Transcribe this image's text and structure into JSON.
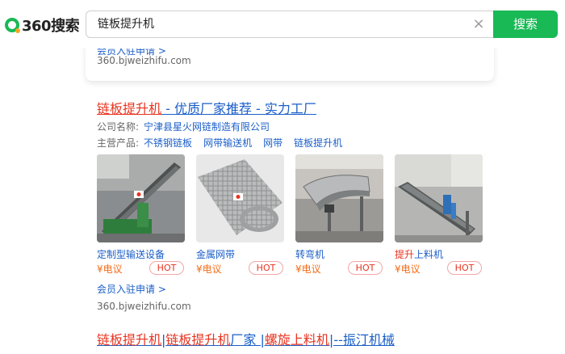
{
  "header": {
    "logo_text": "360搜索",
    "search_value": "链板提升机",
    "clear_glyph": "×",
    "search_button": "搜索",
    "accent_color": "#19b955"
  },
  "dropdown_card": {
    "member_link": "会员入驻申请 >",
    "url": "360.bjweizhifu.com"
  },
  "result1": {
    "title_highlight": "链板提升机",
    "title_rest": " - 优质厂家推荐 - 实力工厂",
    "company_label": "公司名称:",
    "company_value": "宁津县星火网链制造有限公司",
    "products_label": "主营产品:",
    "main_products": [
      "不锈钢链板",
      "网带输送机",
      "网带",
      "链板提升机"
    ],
    "products": [
      {
        "name": "定制型输送设备",
        "price": "¥电议",
        "badge": "HOT",
        "image": "inclined-conveyor-photo"
      },
      {
        "name": "金属网带",
        "price": "¥电议",
        "badge": "HOT",
        "image": "metal-mesh-belt-photo"
      },
      {
        "name": "转弯机",
        "price": "¥电议",
        "badge": "HOT",
        "image": "curved-conveyor-photo"
      },
      {
        "name_highlight": "提升",
        "name_rest": "上料机",
        "price": "¥电议",
        "badge": "HOT",
        "image": "lift-loader-photo"
      }
    ],
    "member_link": "会员入驻申请 >",
    "url": "360.bjweizhifu.com"
  },
  "result2": {
    "part1_hl": "链板提升机",
    "sep1": "|",
    "part2_hl": "链板提升机",
    "part2_rest": "厂家 |",
    "part3_hl": "螺旋上料机",
    "part3_rest": "|--振汀机械"
  }
}
